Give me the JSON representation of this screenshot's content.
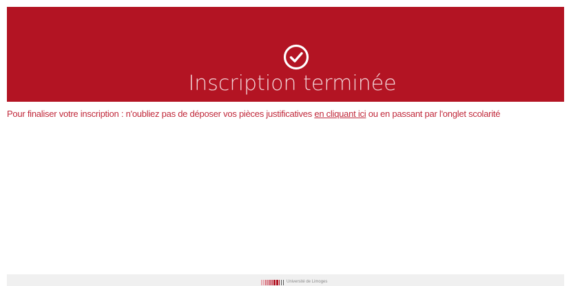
{
  "banner": {
    "icon": "check-circle-icon",
    "title": "Inscription terminée",
    "background_color": "#b31423",
    "title_color": "#f2d4d7"
  },
  "message": {
    "before_link": "Pour finaliser votre inscription : n'oubliez pas de déposer vos pièces justificatives ",
    "link_text": "en cliquant ici",
    "after_link": " ou en passant par l'onglet scolarité",
    "text_color": "#c0283a"
  },
  "footer": {
    "logo_text": "Université de Limoges",
    "background_color": "#f0f0f0"
  }
}
